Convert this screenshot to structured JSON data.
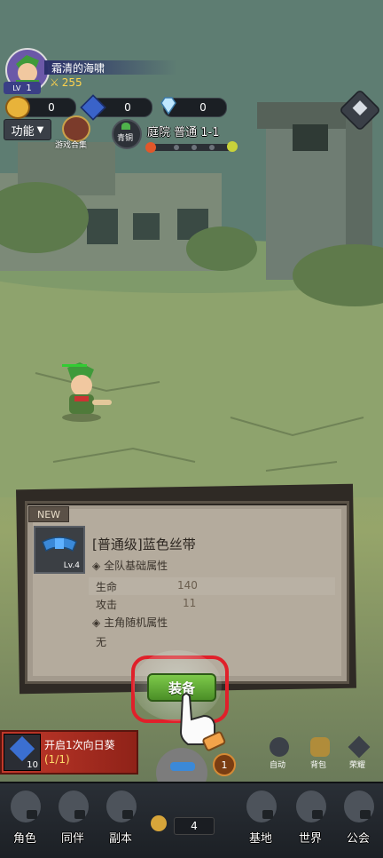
{
  "player": {
    "name": "霜清的海啸",
    "level": "1",
    "power": "255",
    "level_prefix": "LV"
  },
  "resources": [
    {
      "icon": "gold-coin-icon",
      "value": "0"
    },
    {
      "icon": "blue-gem-icon",
      "value": "0"
    },
    {
      "icon": "diamond-icon",
      "value": "0"
    }
  ],
  "hud": {
    "function_label": "功能",
    "game_collection_label": "游戏合集",
    "rank_badge": "青铜",
    "stage_title": "庭院 普通 1-1"
  },
  "item_panel": {
    "new_badge": "NEW",
    "item_name": "[普通级]蓝色丝带",
    "item_level": "Lv.4",
    "team_section": "全队基础属性",
    "stats": [
      {
        "label": "生命",
        "value": "140"
      },
      {
        "label": "攻击",
        "value": "11"
      }
    ],
    "random_section": "主角随机属性",
    "random_value": "无",
    "equip_button": "装备"
  },
  "quest": {
    "label": "开启1次向日葵",
    "progress": "(1/1)",
    "count": "10"
  },
  "side_buttons": [
    {
      "label": "自动"
    },
    {
      "label": "背包"
    },
    {
      "label": "荣耀"
    }
  ],
  "center_badge": "1",
  "center_count": "4",
  "nav": [
    {
      "label": "角色"
    },
    {
      "label": "同伴"
    },
    {
      "label": "副本"
    },
    {
      "label": "基地"
    },
    {
      "label": "世界"
    },
    {
      "label": "公会"
    }
  ],
  "colors": {
    "accent_green": "#5fae33",
    "highlight_red": "#e0202a",
    "panel_bg": "#b4ab9d"
  }
}
